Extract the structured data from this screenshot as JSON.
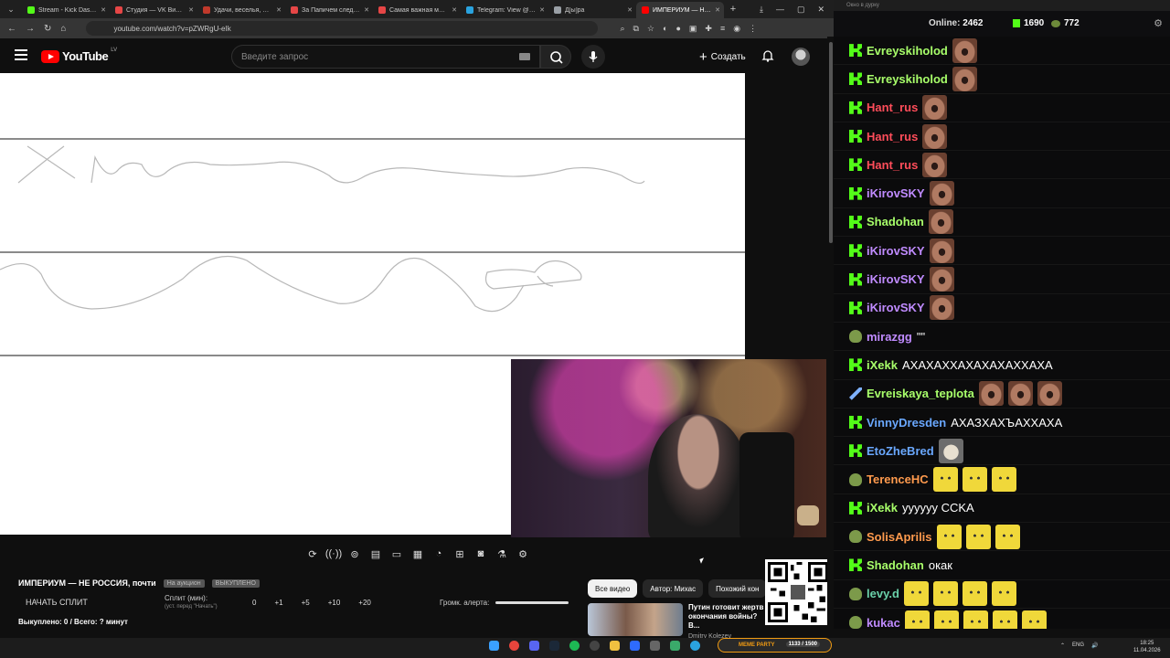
{
  "browser": {
    "tabs": [
      {
        "title": "Stream - Kick Dashboard",
        "favicon": "#53fc18",
        "active": false
      },
      {
        "title": "Студия — VK Видео Live",
        "favicon": "#e64646",
        "active": false
      },
      {
        "title": "Удачи, веселья, не сдавай",
        "favicon": "#c0392b",
        "active": false
      },
      {
        "title": "За Папичем следят в ...",
        "favicon": "#e64646",
        "active": false
      },
      {
        "title": "Самая важная машина ...",
        "favicon": "#e64646",
        "active": false
      },
      {
        "title": "Telegram: View @groks",
        "favicon": "#2aa3df",
        "active": false
      },
      {
        "title": "Д[ы]ра",
        "favicon": "#9aa0a6",
        "active": false
      },
      {
        "title": "ИМПЕРИУМ — НЕ ...",
        "favicon": "#ff0000",
        "active": true
      }
    ],
    "url": "youtube.com/watch?v=pZWRgU-eIk"
  },
  "youtube": {
    "logo_text": "YouTube",
    "country_code": "LV",
    "search_placeholder": "Введите запрос",
    "create_label": "Создать"
  },
  "split": {
    "title": "ИМПЕРИУМ — НЕ РОССИЯ, почти",
    "tag1": "На аукцион",
    "tag2": "ВЫКУПЛЕНО",
    "start_button": "НАЧАТЬ СПЛИТ",
    "split_label": "Сплит (мин):",
    "split_hint": "(уст. перед \"Начать\")",
    "split_values": [
      "0",
      "+1",
      "+5",
      "+10",
      "+20"
    ],
    "alert_label": "Громк. алерта:",
    "bought": "Выкуплено: 0 / Всего: ? минут"
  },
  "related": {
    "chips": [
      "Все видео",
      "Автор: Михас",
      "Похожий кон"
    ],
    "video_title": "Путин готовит жертв окончания войны? В...",
    "video_channel": "Dmitry Kolezev"
  },
  "chat": {
    "window_title": "Окно в дурку",
    "online_label": "Online:",
    "online_count": "2462",
    "kick_count": "1690",
    "pepe_count": "772",
    "messages": [
      {
        "badge": "kick",
        "user": "Evreyskiholod",
        "color": "#a8ff6a",
        "text": "",
        "emotes": [
          "face"
        ]
      },
      {
        "badge": "kick",
        "user": "Evreyskiholod",
        "color": "#a8ff6a",
        "text": "",
        "emotes": [
          "face"
        ]
      },
      {
        "badge": "kick",
        "user": "Hant_rus",
        "color": "#ff4d5a",
        "text": "",
        "emotes": [
          "face"
        ]
      },
      {
        "badge": "kick",
        "user": "Hant_rus",
        "color": "#ff4d5a",
        "text": "",
        "emotes": [
          "face"
        ]
      },
      {
        "badge": "kick",
        "user": "Hant_rus",
        "color": "#ff4d5a",
        "text": "",
        "emotes": [
          "face"
        ]
      },
      {
        "badge": "kick",
        "user": "iKirovSKY",
        "color": "#c08bff",
        "text": "",
        "emotes": [
          "face"
        ]
      },
      {
        "badge": "kick",
        "user": "Shadohan",
        "color": "#a8ff6a",
        "text": "",
        "emotes": [
          "face"
        ]
      },
      {
        "badge": "kick",
        "user": "iKirovSKY",
        "color": "#c08bff",
        "text": "",
        "emotes": [
          "face"
        ]
      },
      {
        "badge": "kick",
        "user": "iKirovSKY",
        "color": "#c08bff",
        "text": "",
        "emotes": [
          "face"
        ]
      },
      {
        "badge": "kick",
        "user": "iKirovSKY",
        "color": "#c08bff",
        "text": "",
        "emotes": [
          "face"
        ]
      },
      {
        "badge": "pepe",
        "user": "mirazgg",
        "color": "#c08bff",
        "text": "\"\"",
        "emotes": []
      },
      {
        "badge": "kick",
        "user": "iXekk",
        "color": "#a8ff6a",
        "text": "АХАХАХХАХАХАХАХХАХА",
        "emotes": []
      },
      {
        "badge": "sword",
        "user": "Evreiskaya_teplota",
        "color": "#a8ff6a",
        "text": "",
        "emotes": [
          "face",
          "face",
          "face"
        ]
      },
      {
        "badge": "kick",
        "user": "VinnyDresden",
        "color": "#6aa8ff",
        "text": "АХАЗХАХЪАХХАХА",
        "emotes": []
      },
      {
        "badge": "kick",
        "user": "EtoZheBred",
        "color": "#6aa8ff",
        "text": "",
        "emotes": [
          "cat"
        ]
      },
      {
        "badge": "pepe",
        "user": "TerenceHC",
        "color": "#ff9a4d",
        "text": "",
        "emotes": [
          "smug",
          "smug",
          "smug"
        ]
      },
      {
        "badge": "kick",
        "user": "iXekk",
        "color": "#a8ff6a",
        "text": "yyyyyy СCKA",
        "emotes": []
      },
      {
        "badge": "pepe",
        "user": "SolisAprilis",
        "color": "#ff9a4d",
        "text": "",
        "emotes": [
          "smug",
          "smug",
          "smug"
        ]
      },
      {
        "badge": "kick",
        "user": "Shadohan",
        "color": "#a8ff6a",
        "text": "окак",
        "emotes": []
      },
      {
        "badge": "pepe",
        "user": "levy.d",
        "color": "#6ad0a8",
        "text": "",
        "emotes": [
          "smug",
          "smug",
          "smug",
          "smug"
        ]
      },
      {
        "badge": "pepe",
        "user": "kukac",
        "color": "#c08bff",
        "text": "",
        "emotes": [
          "smug",
          "smug",
          "smug",
          "smug",
          "smug"
        ]
      }
    ]
  },
  "taskbar": {
    "meme_label": "MEME PARTY",
    "meme_count": "1133 / 1500",
    "lang": "ENG",
    "time": "18:25",
    "date": "11.04.2026"
  }
}
